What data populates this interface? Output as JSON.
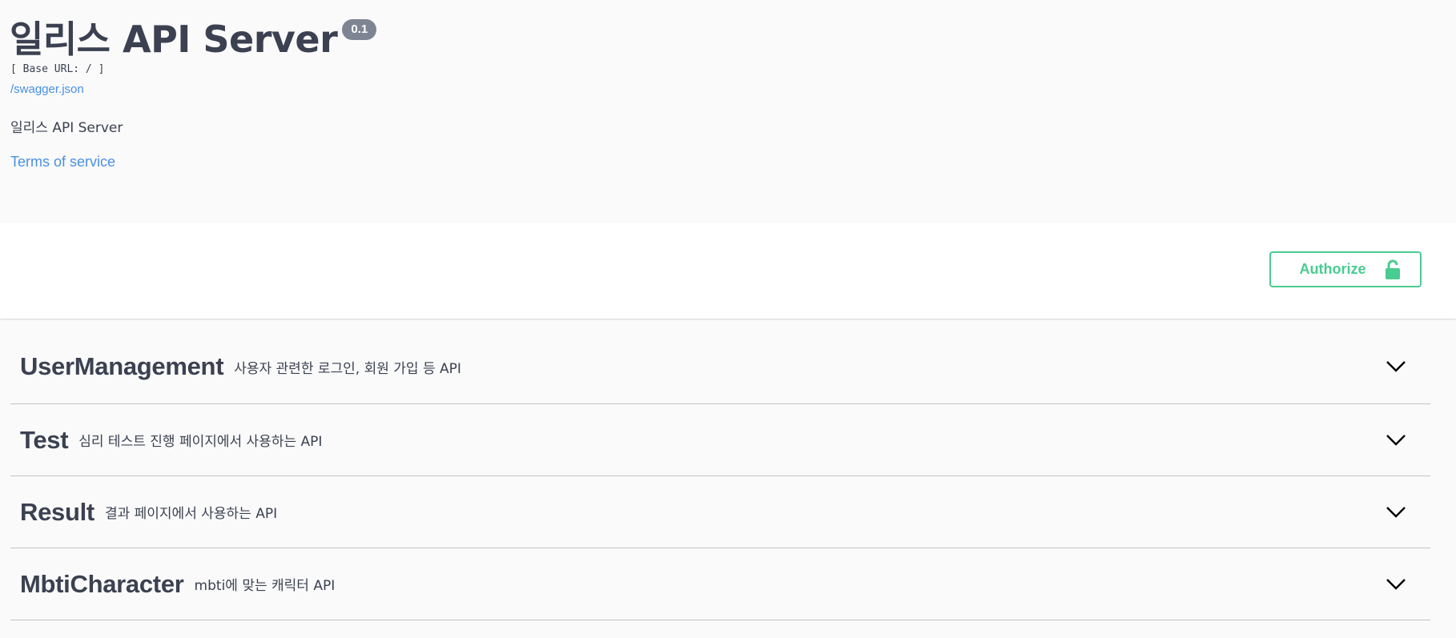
{
  "info": {
    "title": "일리스 API Server",
    "version": "0.1",
    "base_url": "[ Base URL: / ]",
    "swagger_link": "/swagger.json",
    "description": "일리스 API Server",
    "terms_link": "Terms of service"
  },
  "auth": {
    "authorize_label": "Authorize",
    "accent_color": "#49cc90"
  },
  "tags": [
    {
      "name": "UserManagement",
      "description": "사용자 관련한 로그인, 회원 가입 등 API"
    },
    {
      "name": "Test",
      "description": "심리 테스트 진행 페이지에서 사용하는 API"
    },
    {
      "name": "Result",
      "description": "결과 페이지에서 사용하는 API"
    },
    {
      "name": "MbtiCharacter",
      "description": "mbti에 맞는 캐릭터 API"
    }
  ],
  "icons": {
    "lock": "unlocked-lock-icon",
    "expand": "chevron-down-icon"
  },
  "colors": {
    "link": "#4990e2",
    "text": "#3b4151",
    "version_badge": "#7d8492"
  }
}
